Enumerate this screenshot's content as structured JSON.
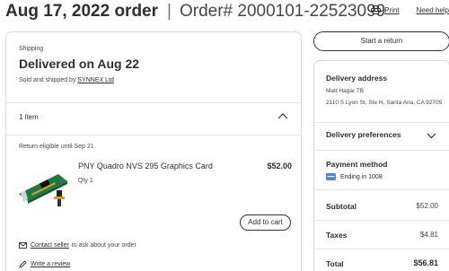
{
  "header": {
    "date": "Aug 17, 2022 order",
    "separator": "|",
    "order_number": "Order# 2000101-22523099",
    "print_label": "Print",
    "help_label": "Need help"
  },
  "shipment": {
    "label": "Shipping",
    "status": "Delivered on Aug 22",
    "sold_prefix": "Sold and shipped by",
    "seller": "SYNNEX Ltd",
    "items_count": "1 item",
    "return_note": "Return eligible until Sep 21",
    "product": {
      "name": "PNY Quadro NVS 295 Graphics Card",
      "price": "$52.00",
      "qty": "Qty 1"
    },
    "add_to_cart": "Add to cart",
    "contact_link": "Contact seller",
    "contact_suffix": "to ask about your order",
    "review_link": "Write a review"
  },
  "sidebar": {
    "return_button": "Start a return",
    "address_heading": "Delivery address",
    "address_name": "Matt Hagar TB",
    "address_line": "2110 S Lyon St, Ste H, Santa Ana, CA 92705",
    "preferences_heading": "Delivery preferences",
    "payment_heading": "Payment method",
    "payment_card": "Ending in 1008",
    "subtotal_label": "Subtotal",
    "subtotal_value": "$52.00",
    "taxes_label": "Taxes",
    "taxes_value": "$4.81",
    "total_label": "Total",
    "total_value": "$56.81"
  },
  "colors": {
    "text": "#2e2f32",
    "muted": "#46474a",
    "border": "#d9d9db",
    "card_blue": "#4a86e8"
  },
  "icons": [
    "printer-icon",
    "chevron-up-icon",
    "chevron-down-icon",
    "mail-icon",
    "pencil-icon",
    "credit-card-icon"
  ]
}
